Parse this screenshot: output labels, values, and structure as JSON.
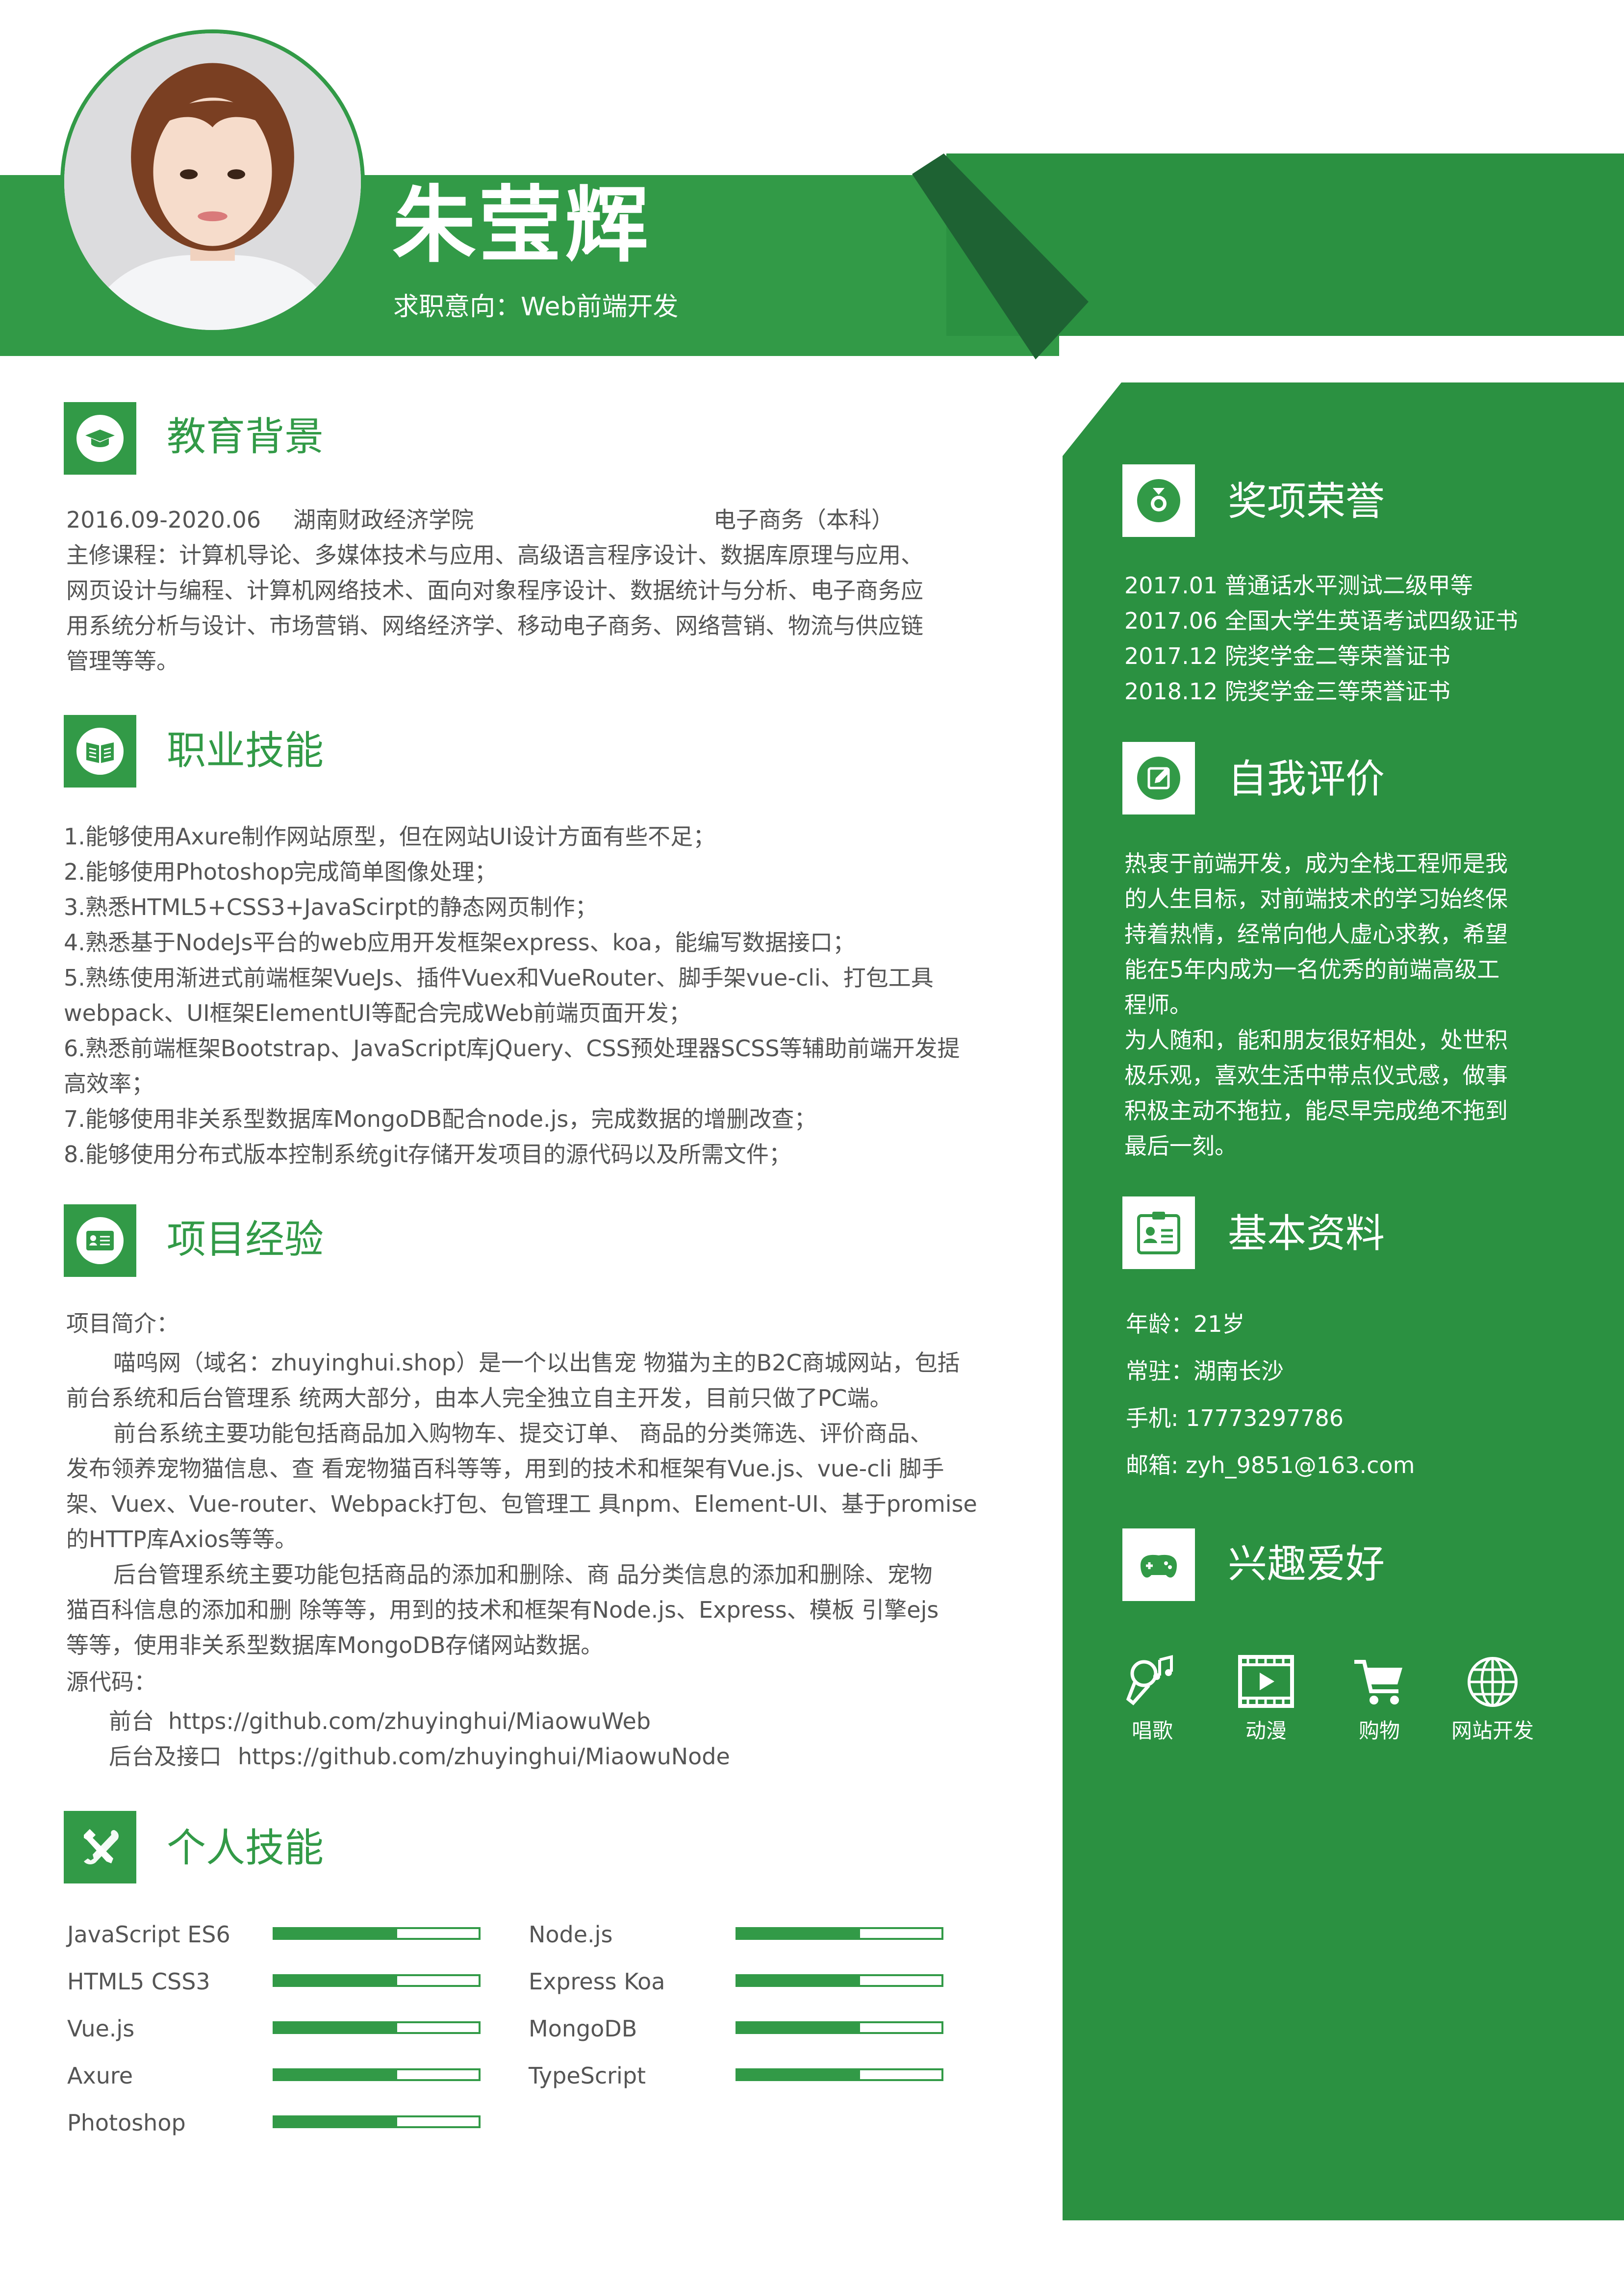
{
  "header": {
    "name": "朱莹辉",
    "intent": "求职意向：Web前端开发"
  },
  "education": {
    "title": "教育背景",
    "period": "2016.09-2020.06",
    "school": "湖南财政经济学院",
    "major": "电子商务（本科）",
    "courses": [
      "主修课程：计算机导论、多媒体技术与应用、高级语言程序设计、数据库原理与应用、",
      "网页设计与编程、计算机网络技术、面向对象程序设计、数据统计与分析、电子商务应",
      "用系统分析与设计、市场营销、网络经济学、移动电子商务、网络营销、物流与供应链",
      "管理等等。"
    ]
  },
  "career_skills": {
    "title": "职业技能",
    "items": [
      "1.能够使用Axure制作网站原型，但在网站UI设计方面有些不足；",
      "2.能够使用Photoshop完成简单图像处理；",
      "3.熟悉HTML5+CSS3+JavaScirpt的静态网页制作；",
      "4.熟悉基于NodeJs平台的web应用开发框架express、koa，能编写数据接口；",
      "5.熟练使用渐进式前端框架VueJs、插件Vuex和VueRouter、脚手架vue-cli、打包工具",
      "webpack、UI框架ElementUI等配合完成Web前端页面开发；",
      "6.熟悉前端框架Bootstrap、JavaScript库jQuery、CSS预处理器SCSS等辅助前端开发提",
      "高效率；",
      "7.能够使用非关系型数据库MongoDB配合node.js，完成数据的增删改查；",
      "8.能够使用分布式版本控制系统git存储开发项目的源代码以及所需文件；"
    ]
  },
  "projects": {
    "title": "项目经验",
    "intro_label": "项目简介：",
    "lines": [
      "喵呜网（域名：zhuyinghui.shop）是一个以出售宠 物猫为主的B2C商城网站，包括",
      "前台系统和后台管理系 统两大部分，由本人完全独立自主开发，目前只做了PC端。",
      "前台系统主要功能包括商品加入购物车、提交订单、 商品的分类筛选、评价商品、",
      "发布领养宠物猫信息、查 看宠物猫百科等等，用到的技术和框架有Vue.js、vue-cli 脚手",
      "架、Vuex、Vue-router、Webpack打包、包管理工 具npm、Element-UI、基于promise",
      "的HTTP库Axios等等。",
      "后台管理系统主要功能包括商品的添加和删除、商 品分类信息的添加和删除、宠物",
      "猫百科信息的添加和删 除等等，用到的技术和框架有Node.js、Express、模板 引擎ejs",
      "等等，使用非关系型数据库MongoDB存储网站数据。"
    ],
    "source_label": "源代码：",
    "front_label": "前台",
    "front_url": "https://github.com/zhuyinghui/MiaowuWeb",
    "back_label": "后台及接口",
    "back_url": "https://github.com/zhuyinghui/MiaowuNode"
  },
  "personal_skills": {
    "title": "个人技能",
    "left": [
      {
        "name": "JavaScript  ES6",
        "level": 0.6
      },
      {
        "name": "HTML5  CSS3",
        "level": 0.6
      },
      {
        "name": "Vue.js",
        "level": 0.6
      },
      {
        "name": "Axure",
        "level": 0.6
      },
      {
        "name": "Photoshop",
        "level": 0.6
      }
    ],
    "right": [
      {
        "name": "Node.js",
        "level": 0.6
      },
      {
        "name": "Express  Koa",
        "level": 0.6
      },
      {
        "name": "MongoDB",
        "level": 0.6
      },
      {
        "name": "TypeScript",
        "level": 0.6
      }
    ]
  },
  "awards": {
    "title": "奖项荣誉",
    "items": [
      "2017.01 普通话水平测试二级甲等",
      "2017.06 全国大学生英语考试四级证书",
      "2017.12 院奖学金二等荣誉证书",
      "2018.12 院奖学金三等荣誉证书"
    ]
  },
  "self_eval": {
    "title": "自我评价",
    "lines": [
      "热衷于前端开发，成为全栈工程师是我",
      "的人生目标，对前端技术的学习始终保",
      "持着热情，经常向他人虚心求教，希望",
      "能在5年内成为一名优秀的前端高级工",
      "程师。",
      "为人随和，能和朋友很好相处，处世积",
      "极乐观，喜欢生活中带点仪式感，做事",
      "积极主动不拖拉，能尽早完成绝不拖到",
      "最后一刻。"
    ]
  },
  "basic_info": {
    "title": "基本资料",
    "age": "年龄：21岁",
    "location": "常驻：湖南长沙",
    "phone": "手机: 17773297786",
    "email": "邮箱: zyh_9851@163.com"
  },
  "hobbies": {
    "title": "兴趣爱好",
    "items": [
      {
        "label": "唱歌",
        "icon": "microphone-icon"
      },
      {
        "label": "动漫",
        "icon": "film-play-icon"
      },
      {
        "label": "购物",
        "icon": "shopping-cart-icon"
      },
      {
        "label": "网站开发",
        "icon": "globe-icon"
      }
    ]
  },
  "colors": {
    "primary": "#329a47",
    "sidebar": "#2b9141",
    "dark": "#1e6233"
  }
}
